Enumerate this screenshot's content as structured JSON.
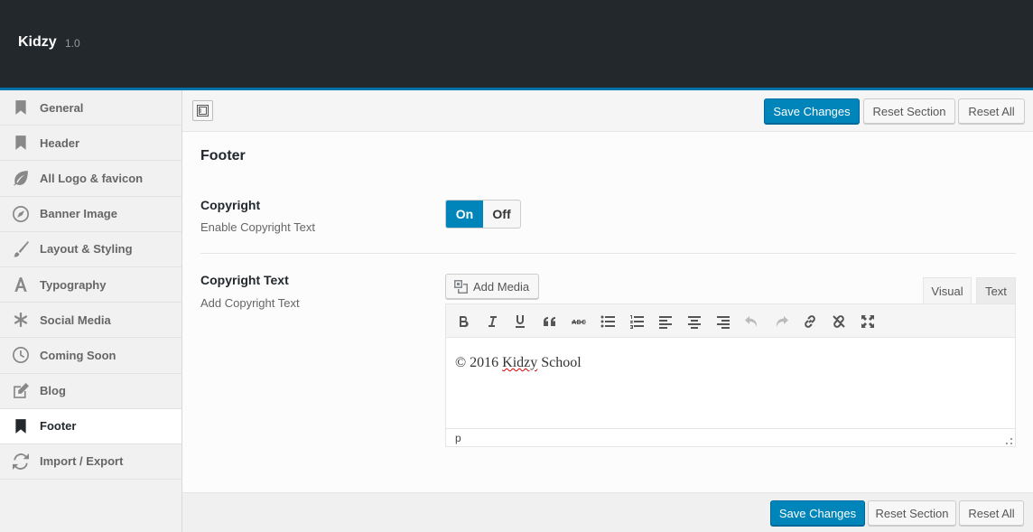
{
  "app": {
    "name": "Kidzy",
    "version": "1.0"
  },
  "sidebar": {
    "items": [
      {
        "label": "General",
        "icon": "bookmark-icon"
      },
      {
        "label": "Header",
        "icon": "bookmark-icon"
      },
      {
        "label": "All Logo & favicon",
        "icon": "leaf-icon"
      },
      {
        "label": "Banner Image",
        "icon": "compass-icon"
      },
      {
        "label": "Layout & Styling",
        "icon": "brush-icon"
      },
      {
        "label": "Typography",
        "icon": "font-icon"
      },
      {
        "label": "Social Media",
        "icon": "asterisk-icon"
      },
      {
        "label": "Coming Soon",
        "icon": "clock-icon"
      },
      {
        "label": "Blog",
        "icon": "edit-icon"
      },
      {
        "label": "Footer",
        "icon": "bookmark-icon",
        "active": true
      },
      {
        "label": "Import / Export",
        "icon": "refresh-icon"
      }
    ]
  },
  "toolbar": {
    "save_label": "Save Changes",
    "reset_section_label": "Reset Section",
    "reset_all_label": "Reset All"
  },
  "section": {
    "title": "Footer",
    "copyright": {
      "title": "Copyright",
      "description": "Enable Copyright Text",
      "on_label": "On",
      "off_label": "Off",
      "value": "On"
    },
    "copyright_text": {
      "title": "Copyright Text",
      "description": "Add Copyright Text",
      "add_media_label": "Add Media",
      "tab_visual": "Visual",
      "tab_text": "Text",
      "content_prefix": "© 2016 ",
      "content_misspelled": "Kidzy",
      "content_suffix": " School",
      "status_path": "p"
    }
  },
  "colors": {
    "accent": "#0085ba",
    "header_bg": "#23282d"
  }
}
